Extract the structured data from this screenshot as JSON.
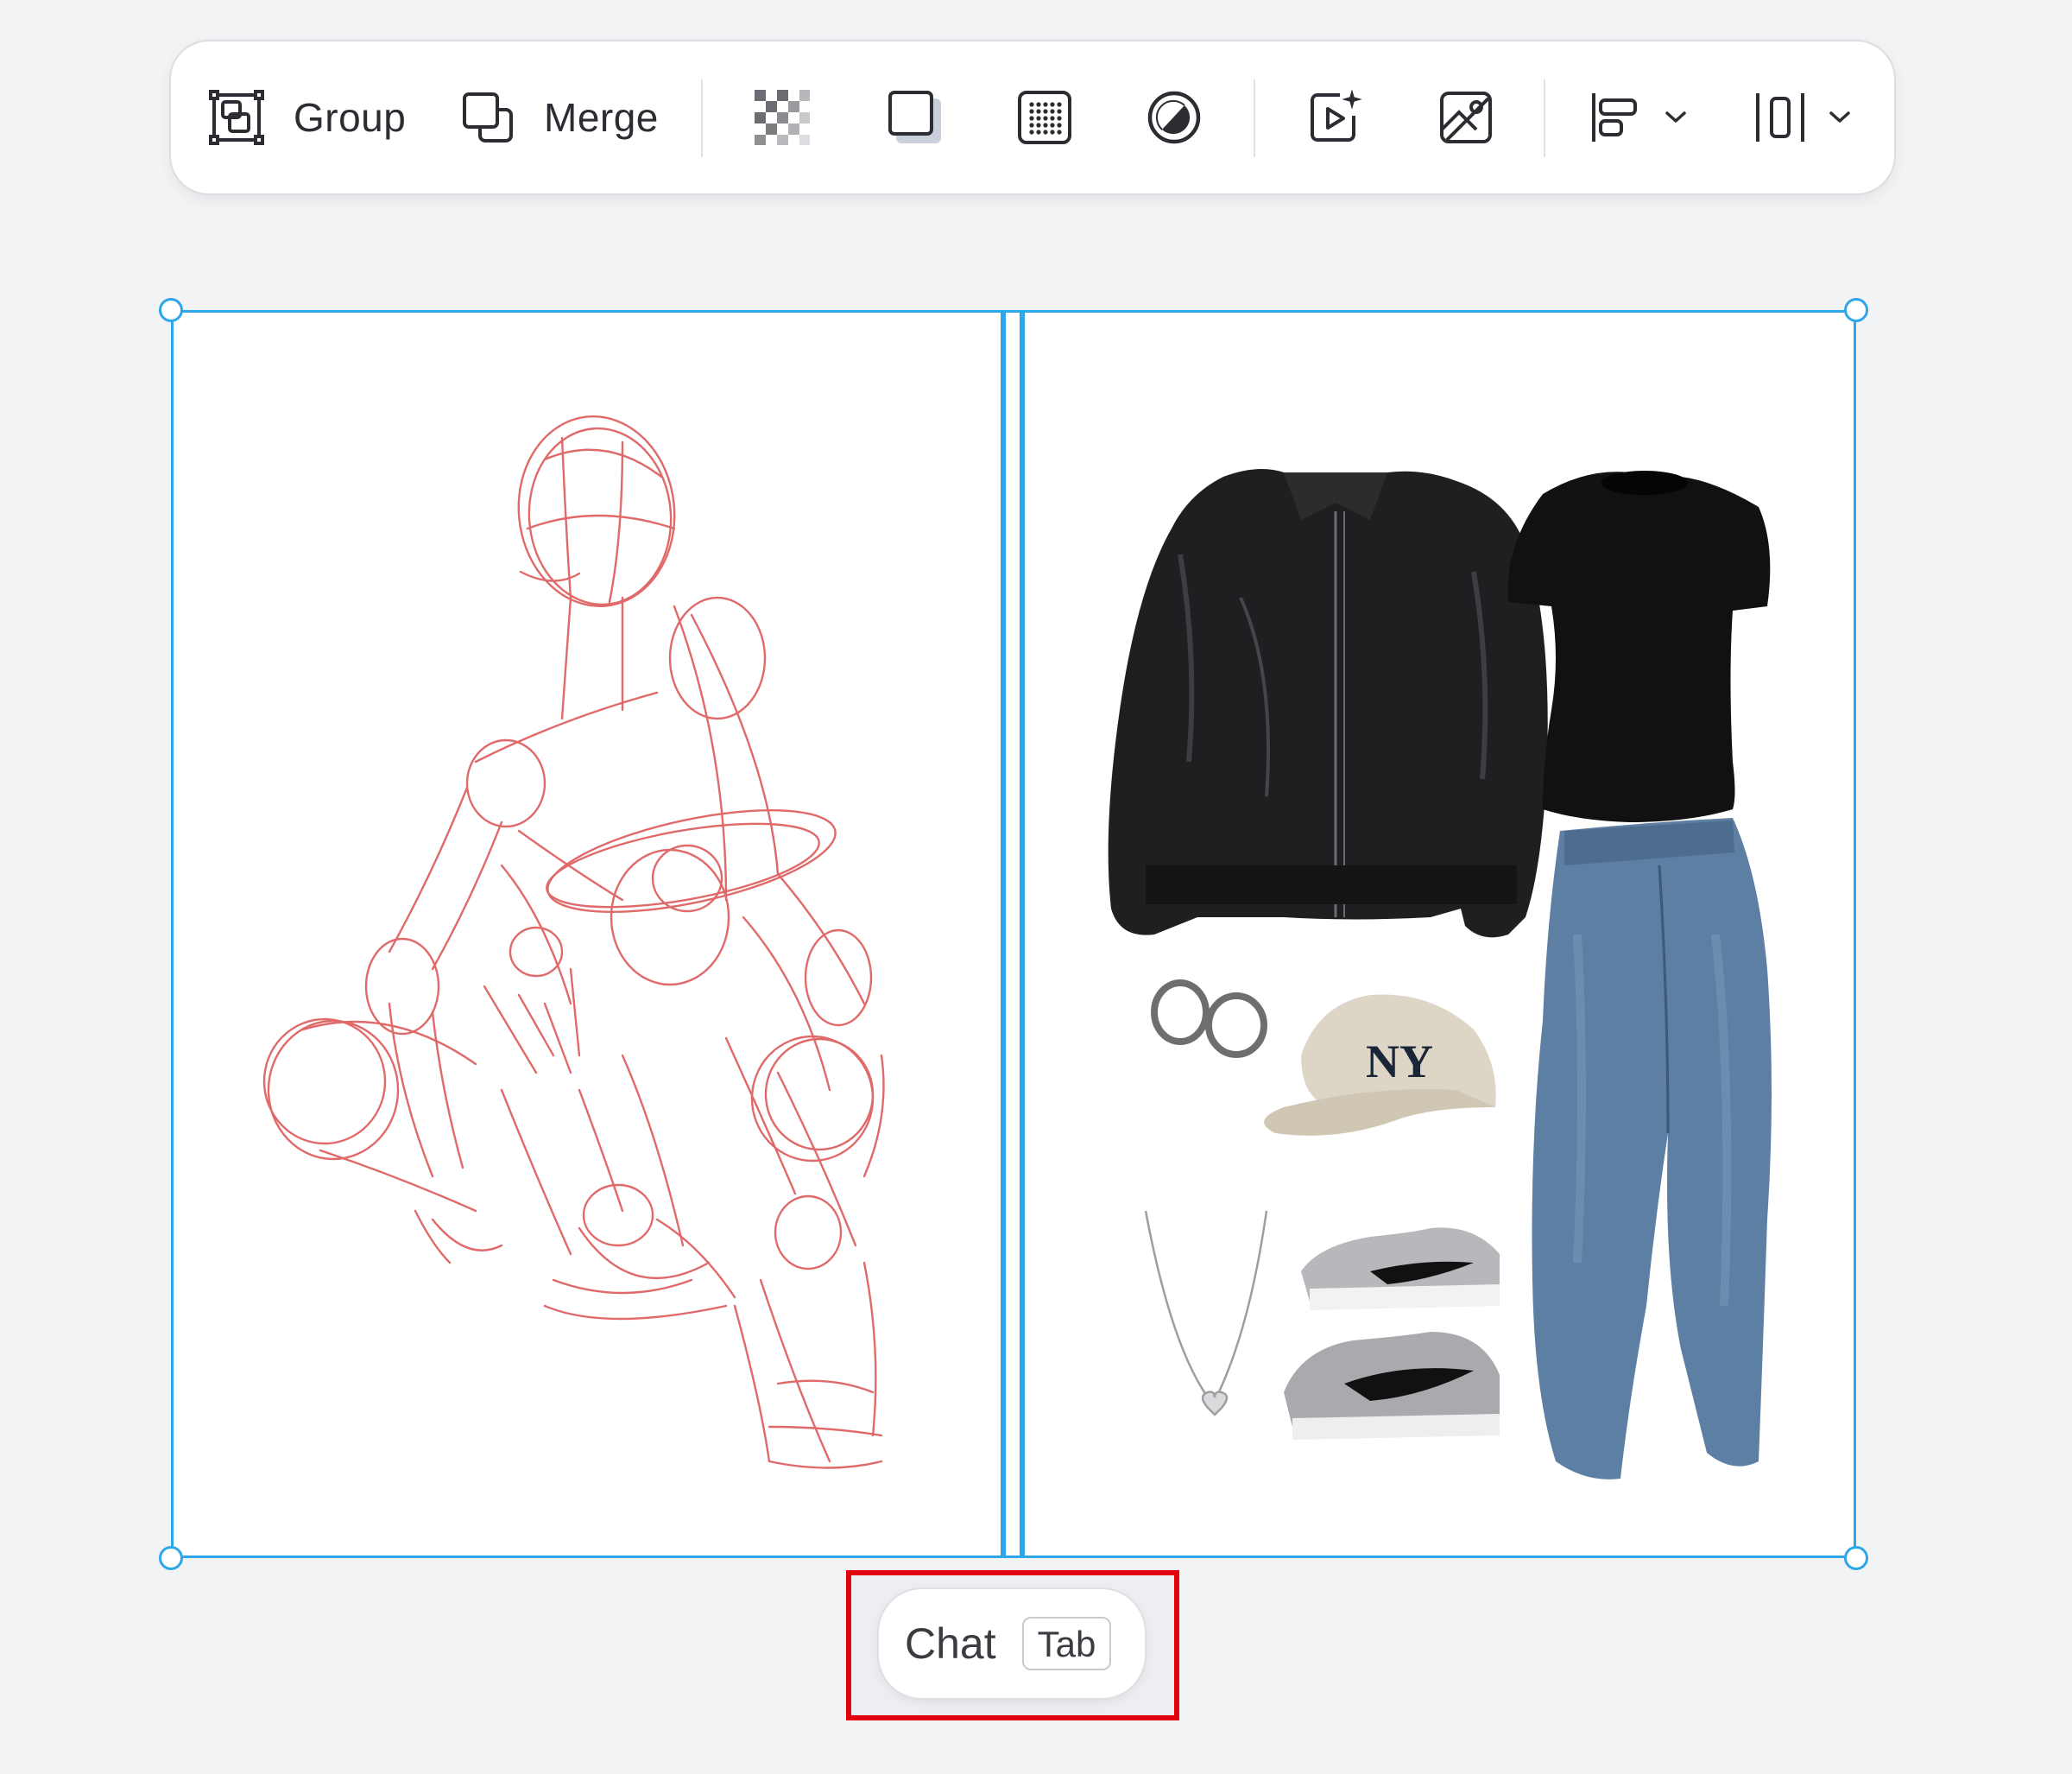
{
  "toolbar": {
    "group_label": "Group",
    "merge_label": "Merge",
    "icons": {
      "group": "group-icon",
      "merge": "merge-icon",
      "transparency": "transparency-checker-icon",
      "shadow": "shadow-square-icon",
      "grid": "dot-grid-icon",
      "adjust": "contrast-adjust-icon",
      "animate": "ai-video-icon",
      "image_edit": "image-edit-icon",
      "align": "align-left-icon",
      "distribute": "distribute-icon"
    }
  },
  "canvas": {
    "left_image": "red sketch of crouching figure",
    "right_image": "outfit moodboard collage"
  },
  "chat": {
    "label": "Chat",
    "shortcut": "Tab"
  },
  "colors": {
    "selection": "#2ea7ea",
    "highlight": "#e3000f",
    "background": "#f2f3f5",
    "sketch": "#e06a6a"
  }
}
